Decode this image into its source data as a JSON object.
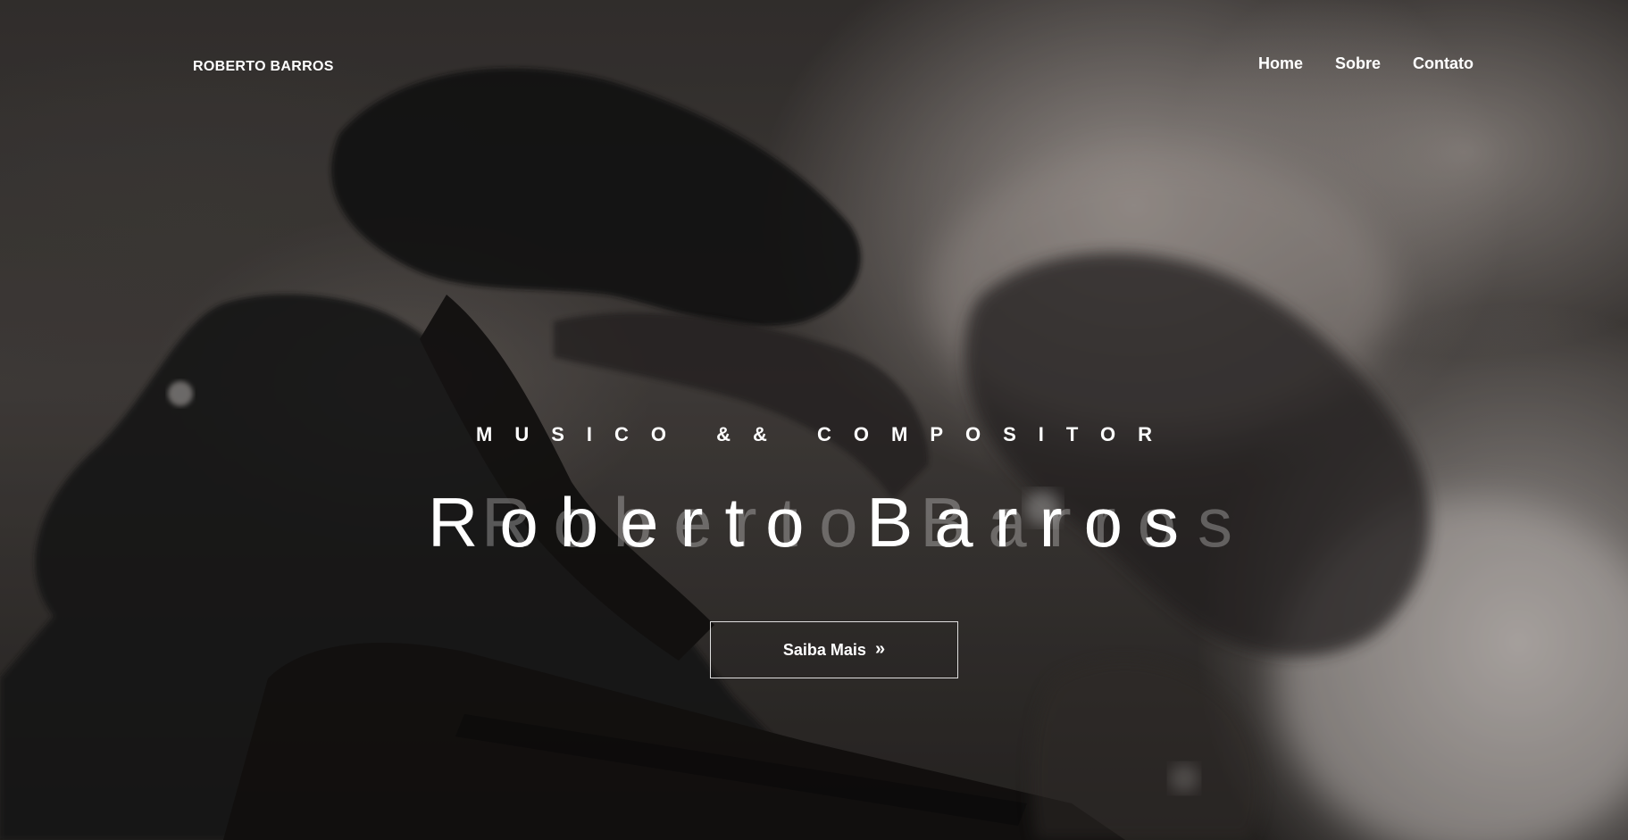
{
  "header": {
    "brand": "ROBERTO BARROS",
    "nav": [
      {
        "label": "Home"
      },
      {
        "label": "Sobre"
      },
      {
        "label": "Contato"
      }
    ]
  },
  "hero": {
    "subtitle": "MUSICO && COMPOSITOR",
    "title": "Roberto Barros",
    "title_echo": "Roberto Barros",
    "cta": {
      "label": "Saiba Mais",
      "icon": "double-chevron-right-icon"
    }
  },
  "colors": {
    "text": "#ffffff",
    "background_dark": "#1a1817",
    "background_light": "#b9b0ab"
  }
}
